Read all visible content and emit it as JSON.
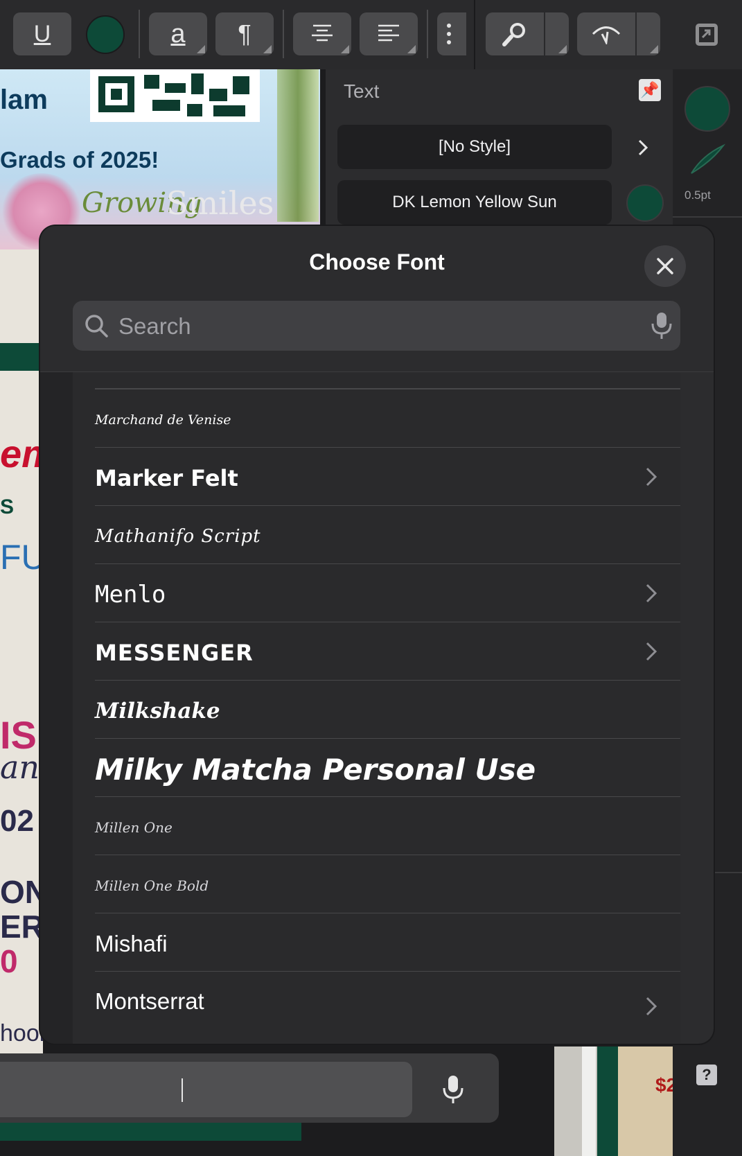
{
  "toolbar": {
    "buttons": [
      {
        "name": "underline-button",
        "glyph": "U"
      },
      {
        "name": "text-color-swatch",
        "color": "#0d4a38"
      },
      {
        "name": "font-style-button",
        "glyph": "a"
      },
      {
        "name": "paragraph-button",
        "glyph": "¶"
      },
      {
        "name": "align-center-button",
        "glyph": ""
      },
      {
        "name": "align-left-button",
        "glyph": ""
      }
    ]
  },
  "canvas": {
    "line1": "lam",
    "line2": "Grads of 2025!",
    "logo_word1": "Growing",
    "logo_word2": "Smiles"
  },
  "text_panel": {
    "title": "Text",
    "paragraph_style": "[No Style]",
    "character_style": "DK Lemon Yellow Sun",
    "swatch_color": "#0d4a38"
  },
  "inspector": {
    "stroke_width": "0.5pt",
    "fill_color": "#0d4a38",
    "help_label": "?"
  },
  "left_doc": {
    "fragments": [
      "em",
      "S",
      "FUN",
      "IS",
      "an",
      "02",
      "ON",
      "ER",
      "0",
      "hool"
    ]
  },
  "right_doc": {
    "fragment": "$2"
  },
  "modal": {
    "title": "Choose Font",
    "search_placeholder": "Search",
    "fonts": [
      {
        "label": "Marchand de Venise",
        "has_chevron": false
      },
      {
        "label": "Marker Felt",
        "has_chevron": true
      },
      {
        "label": "Mathanifo Script",
        "has_chevron": false
      },
      {
        "label": "Menlo",
        "has_chevron": true
      },
      {
        "label": "MESSENGER",
        "has_chevron": true
      },
      {
        "label": "Milkshake",
        "has_chevron": false
      },
      {
        "label": "Milky Matcha Personal Use",
        "has_chevron": false
      },
      {
        "label": "Millen One",
        "has_chevron": false
      },
      {
        "label": "Millen One Bold",
        "has_chevron": false
      },
      {
        "label": "Mishafi",
        "has_chevron": false
      },
      {
        "label": "Montserrat",
        "has_chevron": true
      }
    ]
  }
}
